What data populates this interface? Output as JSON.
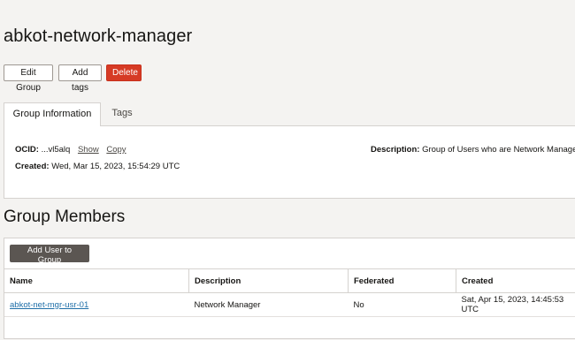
{
  "page": {
    "title": "abkot-network-manager"
  },
  "actions": {
    "edit": "Edit Group",
    "add_tags": "Add tags",
    "delete": "Delete"
  },
  "tabs": [
    {
      "label": "Group Information"
    },
    {
      "label": "Tags"
    }
  ],
  "info": {
    "ocid_label": "OCID:",
    "ocid_value": "...vl5alq",
    "show": "Show",
    "copy": "Copy",
    "created_label": "Created:",
    "created_value": "Wed, Mar 15, 2023, 15:54:29 UTC",
    "description_label": "Description:",
    "description_value": "Group of Users who are Network Managers"
  },
  "members": {
    "title": "Group Members",
    "add_button": "Add User to Group",
    "columns": [
      "Name",
      "Description",
      "Federated",
      "Created"
    ],
    "rows": [
      {
        "name": "abkot-net-mgr-usr-01",
        "description": "Network Manager",
        "federated": "No",
        "created": "Sat, Apr 15, 2023, 14:45:53 UTC"
      }
    ]
  }
}
